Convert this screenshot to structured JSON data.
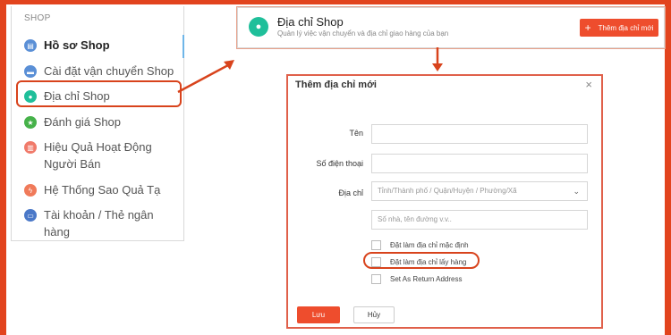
{
  "sidebar": {
    "heading": "SHOP",
    "items": [
      {
        "label": "Hồ sơ Shop",
        "icon": "profile-icon",
        "color": "#5a8fd6"
      },
      {
        "label": "Cài đặt vận chuyển Shop",
        "icon": "truck-icon",
        "color": "#5a8fd6"
      },
      {
        "label": "Địa chỉ Shop",
        "icon": "location-pin-icon",
        "color": "#1fbf9a"
      },
      {
        "label": "Đánh giá Shop",
        "icon": "star-icon",
        "color": "#46b24a"
      },
      {
        "label": "Hiệu Quả Hoạt Động\nNgười Bán",
        "icon": "chart-icon",
        "color": "#f07a6a"
      },
      {
        "label": "Hệ Thống Sao Quả Tạ",
        "icon": "lightning-icon",
        "color": "#f07a5a"
      },
      {
        "label": "Tài khoản / Thẻ ngân\nhàng",
        "icon": "bank-card-icon",
        "color": "#4a78c8"
      }
    ]
  },
  "header": {
    "title": "Địa chỉ Shop",
    "subtitle": "Quản lý việc vận chuyển và địa chỉ giao hàng của bạn",
    "add_button": "Thêm địa chỉ mới"
  },
  "modal": {
    "title": "Thêm địa chỉ mới",
    "name_label": "Tên",
    "phone_label": "Số điện thoại",
    "address_label": "Địa chỉ",
    "address_placeholder": "Tỉnh/Thành phố / Quận/Huyện / Phường/Xã",
    "street_placeholder": "Số nhà, tên đường v.v..",
    "checkboxes": [
      "Đặt làm địa chỉ mặc định",
      "Đặt làm địa chỉ lấy hàng",
      "Set As Return Address"
    ],
    "save_button": "Lưu",
    "cancel_button": "Hủy"
  },
  "colors": {
    "accent": "#ee4d2d",
    "frame": "#e2441e"
  }
}
